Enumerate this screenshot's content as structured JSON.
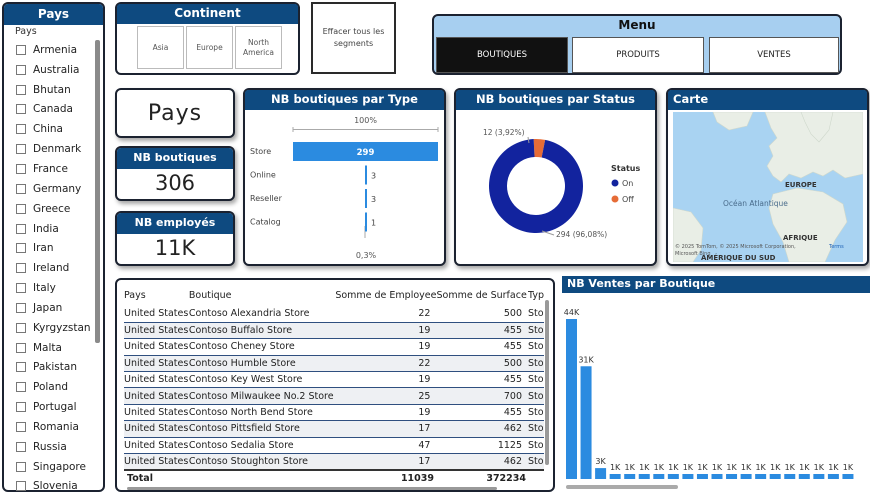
{
  "pays_slicer": {
    "title": "Pays",
    "subtitle": "Pays",
    "items": [
      "Armenia",
      "Australia",
      "Bhutan",
      "Canada",
      "China",
      "Denmark",
      "France",
      "Germany",
      "Greece",
      "India",
      "Iran",
      "Ireland",
      "Italy",
      "Japan",
      "Kyrgyzstan",
      "Malta",
      "Pakistan",
      "Poland",
      "Portugal",
      "Romania",
      "Russia",
      "Singapore",
      "Slovenia"
    ]
  },
  "continent": {
    "title": "Continent",
    "options": [
      "Asia",
      "Europe",
      "North America"
    ]
  },
  "clear_button": "Effacer tous les segments",
  "menu": {
    "title": "Menu",
    "buttons": [
      "BOUTIQUES",
      "PRODUITS",
      "VENTES"
    ],
    "active": "BOUTIQUES"
  },
  "kpi": {
    "pays_label": "Pays",
    "nb_boutiques_title": "NB boutiques",
    "nb_boutiques_value": "306",
    "nb_employes_title": "NB employés",
    "nb_employes_value": "11K"
  },
  "type_chart": {
    "title": "NB boutiques par Type",
    "top_label": "100%",
    "bottom_label": "0,3%",
    "chart_data": {
      "type": "bar",
      "categories": [
        "Store",
        "Online",
        "Reseller",
        "Catalog"
      ],
      "values": [
        299,
        3,
        3,
        1
      ],
      "value_labels": [
        "299",
        "3",
        "3",
        "1"
      ]
    },
    "color": "#2b8be0"
  },
  "status_chart": {
    "title": "NB boutiques par Status",
    "legend_title": "Status",
    "chart_data": {
      "type": "pie",
      "categories": [
        "On",
        "Off"
      ],
      "values": [
        294,
        12
      ],
      "labels": [
        "294 (96,08%)",
        "12 (3,92%)"
      ]
    },
    "colors": {
      "On": "#12239e",
      "Off": "#e66c37"
    }
  },
  "map": {
    "title": "Carte",
    "labels": {
      "europe": "EUROPE",
      "ocean": "Océan Atlantique",
      "afrique": "AFRIQUE",
      "amerique": "AMÉRIQUE DU SUD",
      "credit": "© 2025 TomTom, © 2025 Microsoft Corporation,",
      "terms": "Terms",
      "provider": "Microsoft Bing"
    }
  },
  "table": {
    "columns": [
      "Pays",
      "Boutique",
      "Somme de Employee",
      "Somme de Surface",
      "Typ"
    ],
    "rows": [
      [
        "United States",
        "Contoso Alexandria Store",
        "22",
        "500",
        "Sto"
      ],
      [
        "United States",
        "Contoso Buffalo Store",
        "19",
        "455",
        "Sto"
      ],
      [
        "United States",
        "Contoso Cheney Store",
        "19",
        "455",
        "Sto"
      ],
      [
        "United States",
        "Contoso Humble Store",
        "22",
        "500",
        "Sto"
      ],
      [
        "United States",
        "Contoso Key West Store",
        "19",
        "455",
        "Sto"
      ],
      [
        "United States",
        "Contoso Milwaukee No.2 Store",
        "25",
        "700",
        "Sto"
      ],
      [
        "United States",
        "Contoso North Bend Store",
        "19",
        "455",
        "Sto"
      ],
      [
        "United States",
        "Contoso Pittsfield Store",
        "17",
        "462",
        "Sto"
      ],
      [
        "United States",
        "Contoso Sedalia Store",
        "47",
        "1125",
        "Sto"
      ],
      [
        "United States",
        "Contoso Stoughton Store",
        "17",
        "462",
        "Sto"
      ]
    ],
    "total": {
      "label": "Total",
      "employee": "11039",
      "surface": "372234"
    }
  },
  "sales_chart": {
    "title": "NB Ventes par Boutique",
    "color": "#2b8be0",
    "chart_data": {
      "type": "bar",
      "values": [
        44000,
        31000,
        3000,
        1000,
        1000,
        1000,
        1000,
        1000,
        1000,
        1000,
        1000,
        1000,
        1000,
        1000,
        1000,
        1000,
        1000,
        1000,
        1000,
        1000
      ],
      "value_labels": [
        "44K",
        "31K",
        "3K",
        "1K",
        "1K",
        "1K",
        "1K",
        "1K",
        "1K",
        "1K",
        "1K",
        "1K",
        "1K",
        "1K",
        "1K",
        "1K",
        "1K",
        "1K",
        "1K",
        "1K"
      ]
    }
  }
}
